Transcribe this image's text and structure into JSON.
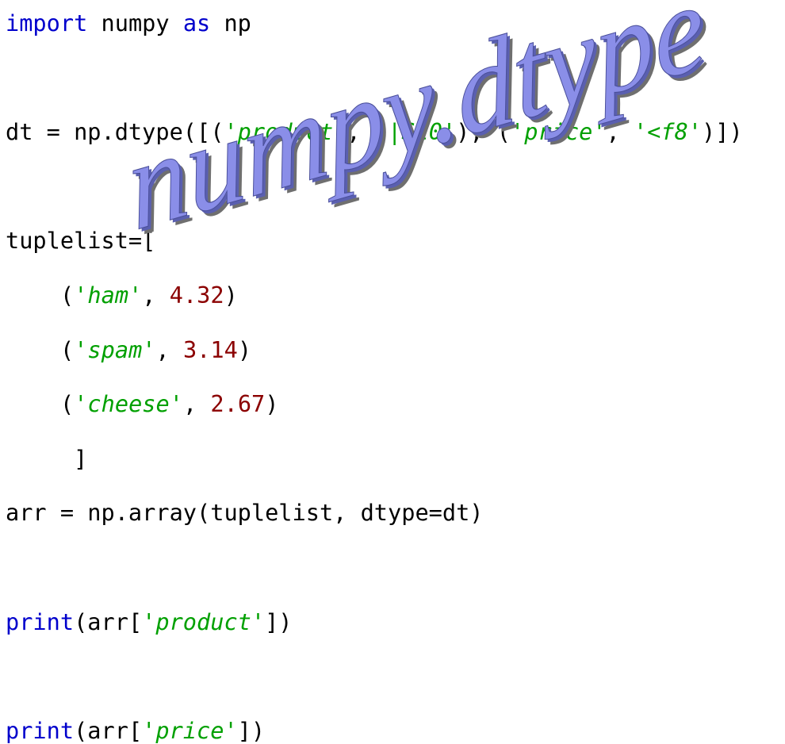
{
  "code": {
    "l1": {
      "kw1": "import",
      "t1": " numpy ",
      "kw2": "as",
      "t2": " np"
    },
    "l3": {
      "t1": "dt = np.dtype([(",
      "s1": "'product'",
      "t2": ", ",
      "s2": "'|S10'",
      "t3": "), (",
      "s3": "'price'",
      "t4": ", ",
      "s4": "'<f8'",
      "t5": ")])"
    },
    "l5": {
      "t1": "tuplelist=["
    },
    "l6": {
      "t1": "(",
      "s1": "'ham'",
      "t2": ", ",
      "n1": "4.32",
      "t3": ")"
    },
    "l7": {
      "t1": "(",
      "s1": "'spam'",
      "t2": ", ",
      "n1": "3.14",
      "t3": ")"
    },
    "l8": {
      "t1": "(",
      "s1": "'cheese'",
      "t2": ", ",
      "n1": "2.67",
      "t3": ")"
    },
    "l9": {
      "t1": "]"
    },
    "l10": {
      "t1": "arr = np.array(tuplelist, dtype=dt)"
    },
    "l12": {
      "kw": "print",
      "t1": "(arr[",
      "s1": "'product'",
      "t2": "])"
    },
    "l14": {
      "kw": "print",
      "t1": "(arr[",
      "s1": "'price'",
      "t2": "])"
    }
  },
  "wordart": {
    "text": "numpy.dtype",
    "fill": "#8a8ee8",
    "shadow": "#6f6f6f"
  }
}
